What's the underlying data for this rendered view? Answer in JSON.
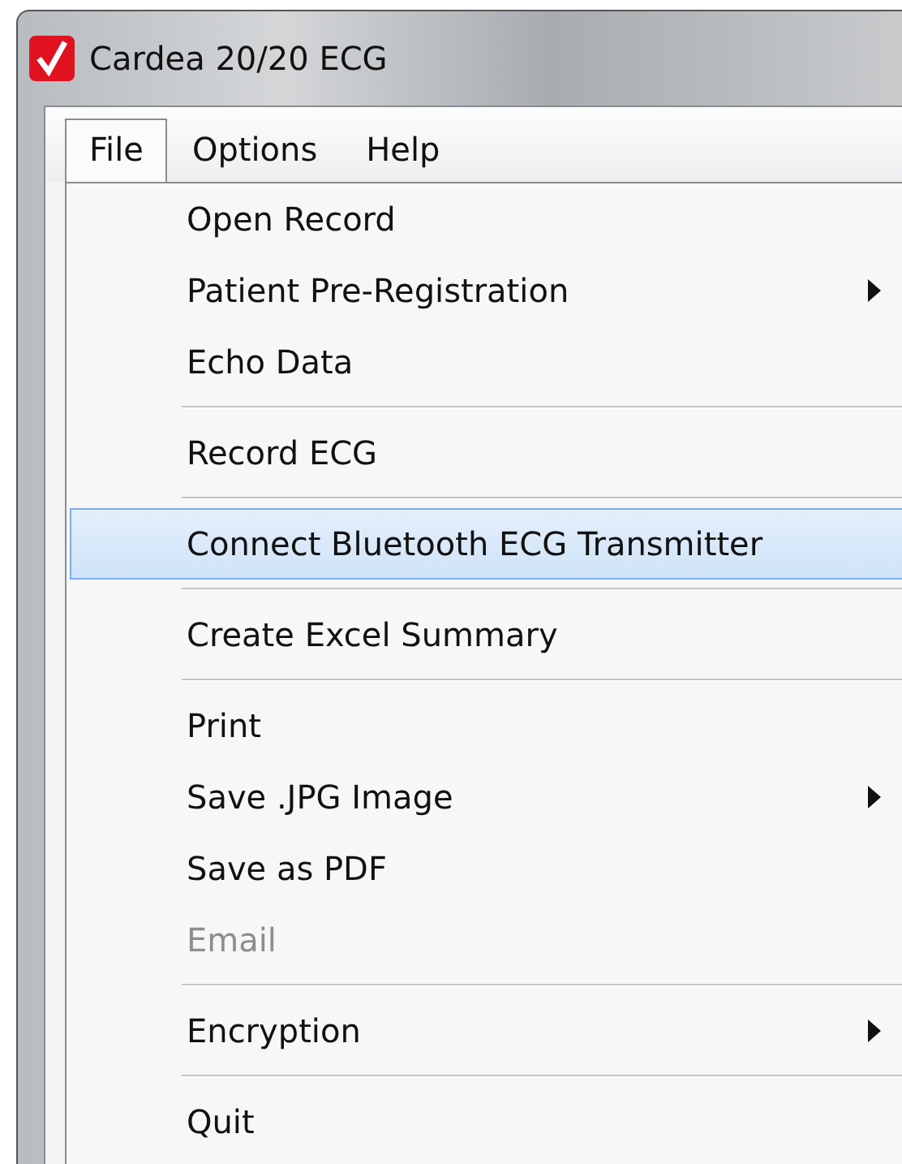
{
  "window": {
    "title": "Cardea 20/20 ECG"
  },
  "menu_bar": [
    {
      "label": "File",
      "selected": true
    },
    {
      "label": "Options",
      "selected": false
    },
    {
      "label": "Help",
      "selected": false
    }
  ],
  "menu": {
    "items": [
      {
        "kind": "item",
        "label": "Open Record",
        "submenu": false,
        "disabled": false,
        "selected": false
      },
      {
        "kind": "item",
        "label": "Patient Pre-Registration",
        "submenu": true,
        "disabled": false,
        "selected": false
      },
      {
        "kind": "item",
        "label": "Echo Data",
        "submenu": false,
        "disabled": false,
        "selected": false
      },
      {
        "kind": "separator"
      },
      {
        "kind": "item",
        "label": "Record ECG",
        "submenu": false,
        "disabled": false,
        "selected": false
      },
      {
        "kind": "separator"
      },
      {
        "kind": "item",
        "label": "Connect Bluetooth ECG Transmitter",
        "submenu": false,
        "disabled": false,
        "selected": true
      },
      {
        "kind": "separator"
      },
      {
        "kind": "item",
        "label": "Create Excel Summary",
        "submenu": false,
        "disabled": false,
        "selected": false
      },
      {
        "kind": "separator"
      },
      {
        "kind": "item",
        "label": "Print",
        "submenu": false,
        "disabled": false,
        "selected": false
      },
      {
        "kind": "item",
        "label": "Save .JPG Image",
        "submenu": true,
        "disabled": false,
        "selected": false
      },
      {
        "kind": "item",
        "label": "Save as PDF",
        "submenu": false,
        "disabled": false,
        "selected": false
      },
      {
        "kind": "item",
        "label": "Email",
        "submenu": false,
        "disabled": true,
        "selected": false
      },
      {
        "kind": "separator"
      },
      {
        "kind": "item",
        "label": "Encryption",
        "submenu": true,
        "disabled": false,
        "selected": false
      },
      {
        "kind": "separator"
      },
      {
        "kind": "item",
        "label": "Quit",
        "submenu": false,
        "disabled": false,
        "selected": false
      }
    ]
  }
}
